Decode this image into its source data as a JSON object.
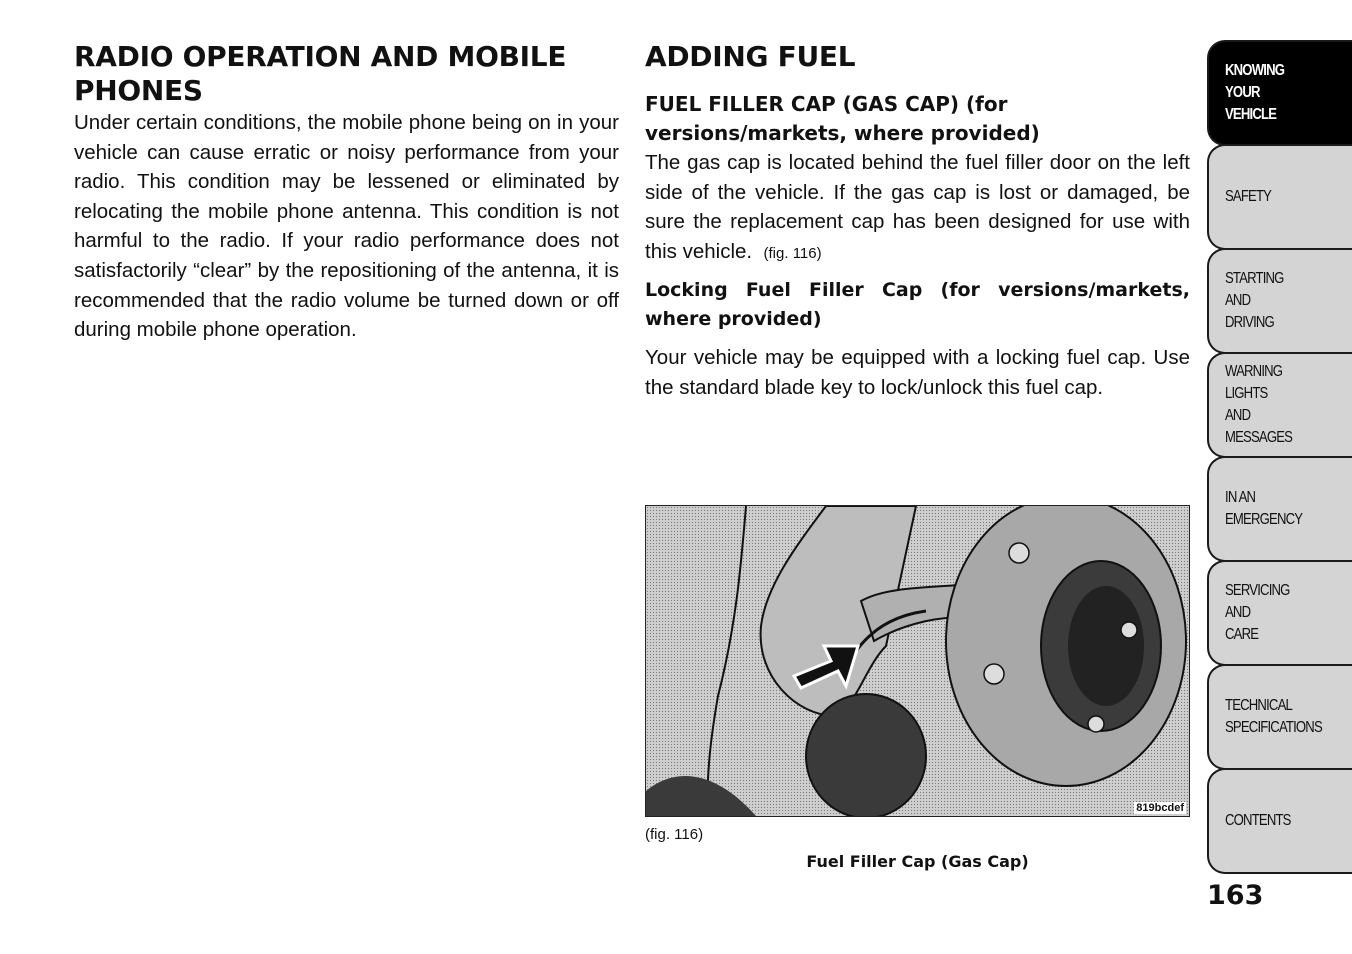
{
  "left_section": {
    "title": "RADIO OPERATION AND MOBILE PHONES",
    "paragraph": "Under certain conditions, the mobile phone being on in your vehicle can cause erratic or noisy performance from your radio. This condition may be lessened or eliminated by relocating the mobile phone antenna. This condition is not harmful to the radio. If your radio performance does not satisfactorily “clear” by the repositioning of the antenna, it is recommended that the radio volume be turned down or off during mobile phone operation."
  },
  "right_section": {
    "title": "ADDING FUEL",
    "subsection_1": {
      "heading": "FUEL FILLER CAP (GAS CAP) (for versions/markets, where provided)",
      "paragraph": "The gas cap is located behind the fuel filler door on the left side of the vehicle. If the gas cap is lost or damaged, be sure the replacement cap has been designed for use with this vehicle.",
      "fig_ref": "(fig. 116)"
    },
    "subsection_2": {
      "heading": "Locking Fuel Filler Cap (for versions/markets, where provided)",
      "paragraph": "Your vehicle may be equipped with a locking fuel cap. Use the standard blade key to lock/unlock this fuel cap."
    },
    "figure": {
      "code": "819bcdef",
      "label": "(fig. 116)",
      "caption": "Fuel Filler Cap (Gas Cap)"
    }
  },
  "side_tabs": [
    {
      "label": "KNOWING\nYOUR\nVEHICLE",
      "active": true
    },
    {
      "label": "SAFETY",
      "active": false
    },
    {
      "label": "STARTING\nAND\nDRIVING",
      "active": false
    },
    {
      "label": "WARNING\nLIGHTS\nAND\nMESSAGES",
      "active": false
    },
    {
      "label": "IN AN\nEMERGENCY",
      "active": false
    },
    {
      "label": "SERVICING\nAND\nCARE",
      "active": false
    },
    {
      "label": "TECHNICAL\nSPECIFICATIONS",
      "active": false
    },
    {
      "label": "CONTENTS",
      "active": false
    }
  ],
  "page_number": "163"
}
